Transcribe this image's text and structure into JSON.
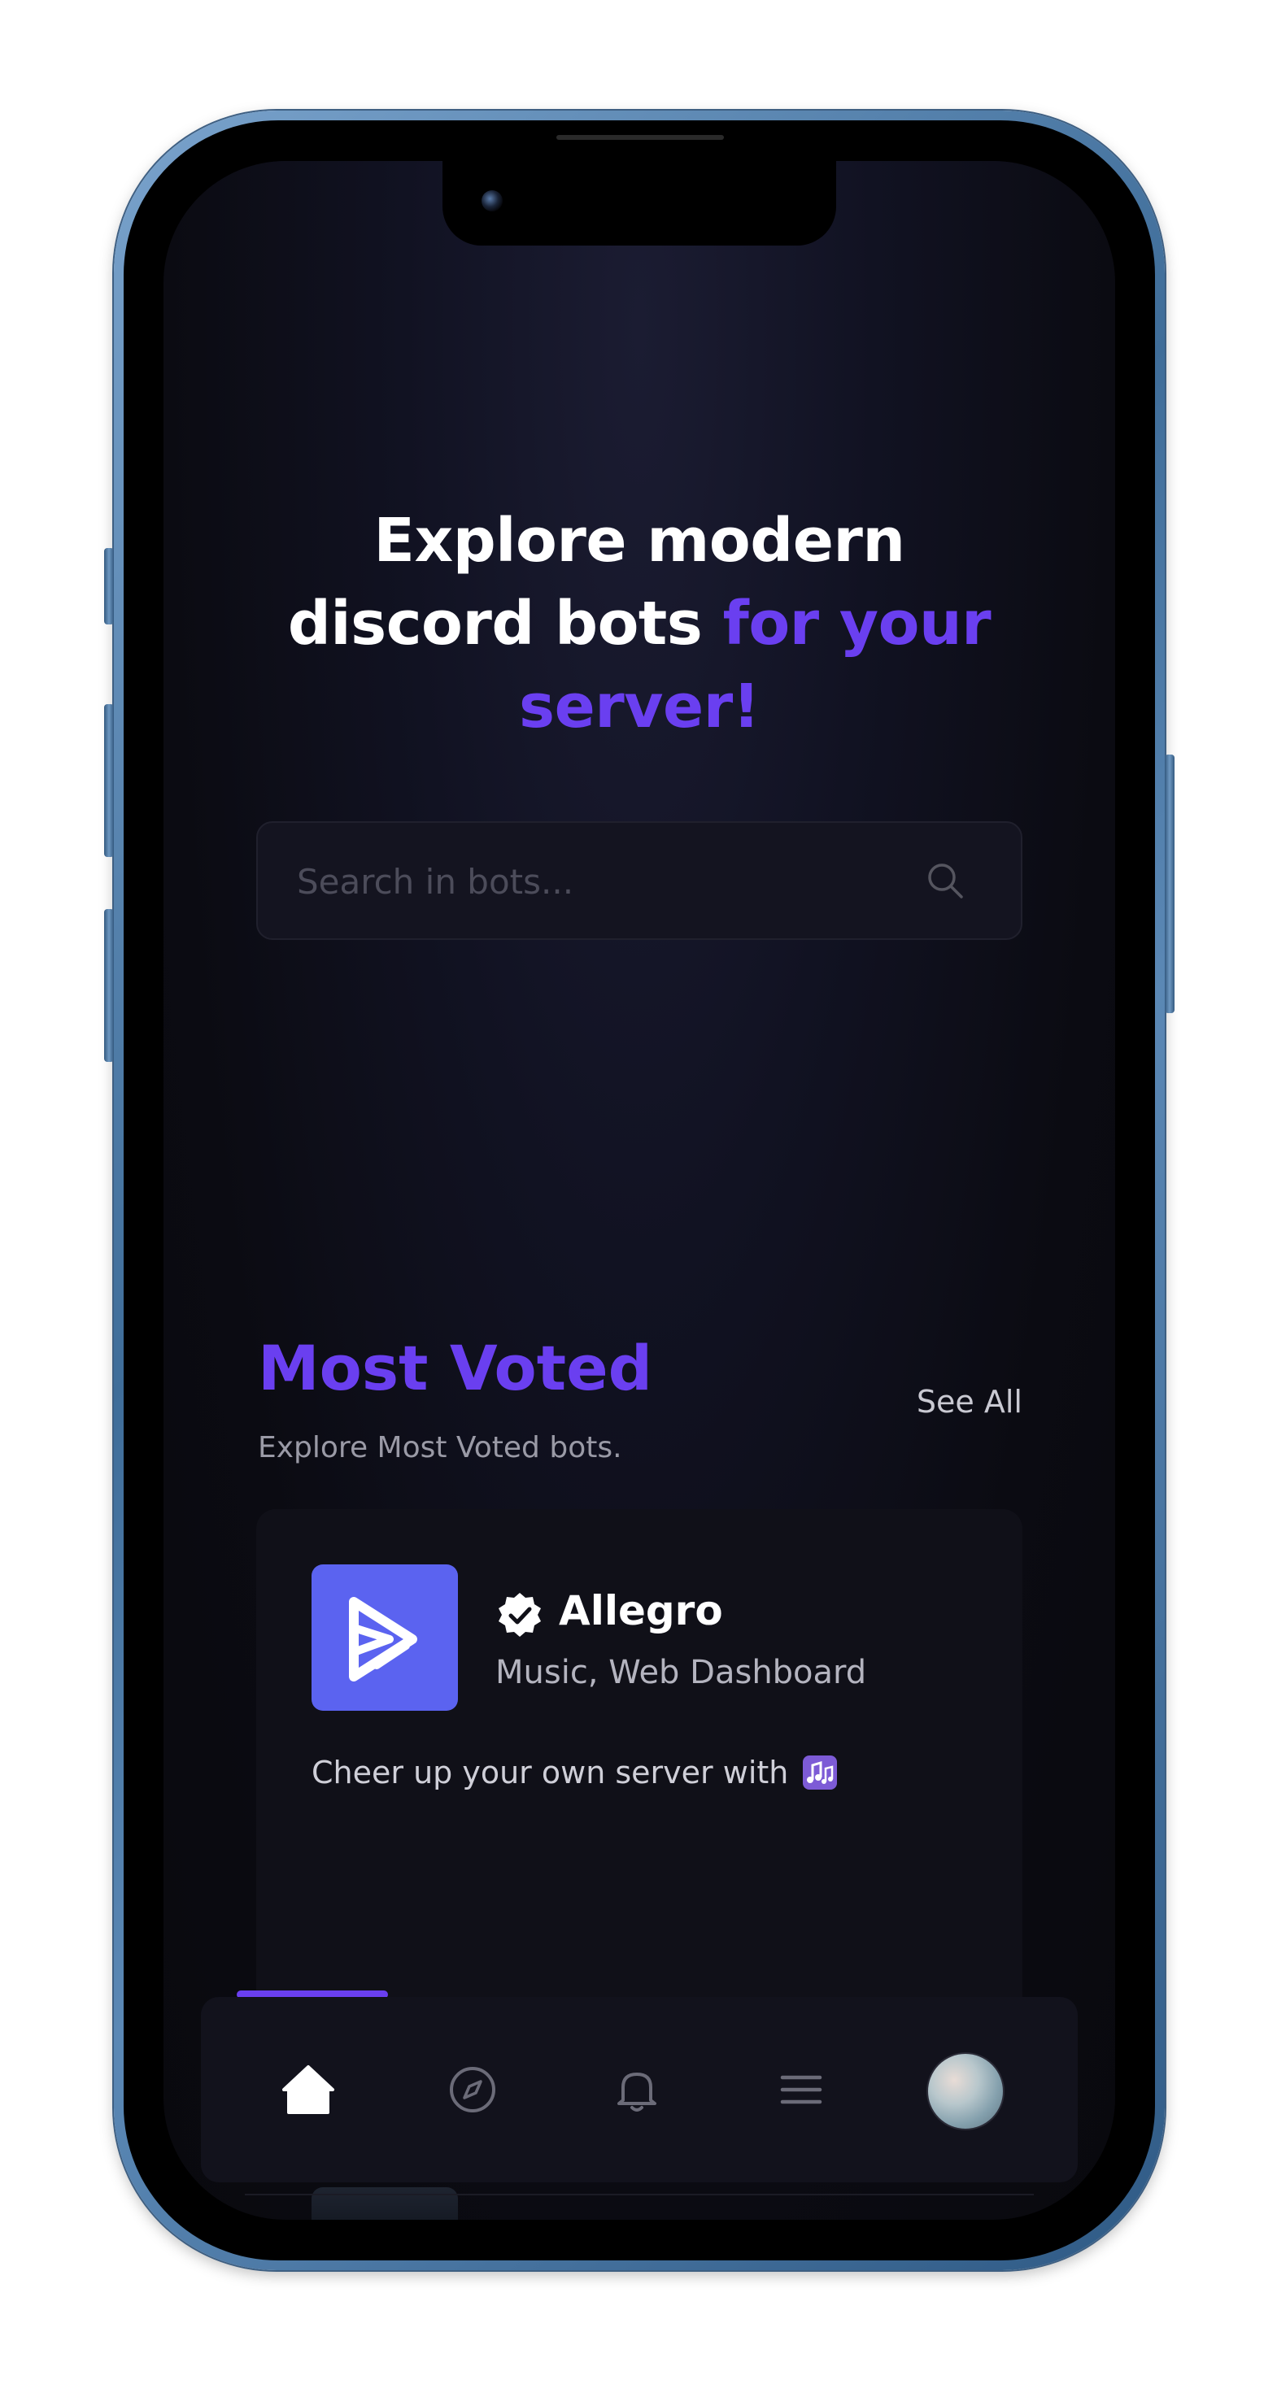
{
  "hero": {
    "line1": "Explore modern",
    "line2_white": "discord bots",
    "line2_accent": "for your",
    "line3_accent": "server!"
  },
  "search": {
    "placeholder": "Search in bots...",
    "icon": "search-icon"
  },
  "most_voted": {
    "title": "Most Voted",
    "subtitle": "Explore Most Voted bots.",
    "see_all": "See All"
  },
  "bot_card": {
    "name": "Allegro",
    "tags": "Music, Web Dashboard",
    "description": "Cheer up your own server with",
    "verified": true,
    "avatar_color": "#5b63f0",
    "emoji": "musical-notes"
  },
  "nav": {
    "items": [
      "home-icon",
      "compass-icon",
      "bell-icon",
      "menu-icon",
      "profile-avatar"
    ],
    "active": "home"
  },
  "colors": {
    "accent": "#6a3ff0",
    "background": "#0b0b12",
    "card": "#101018"
  }
}
